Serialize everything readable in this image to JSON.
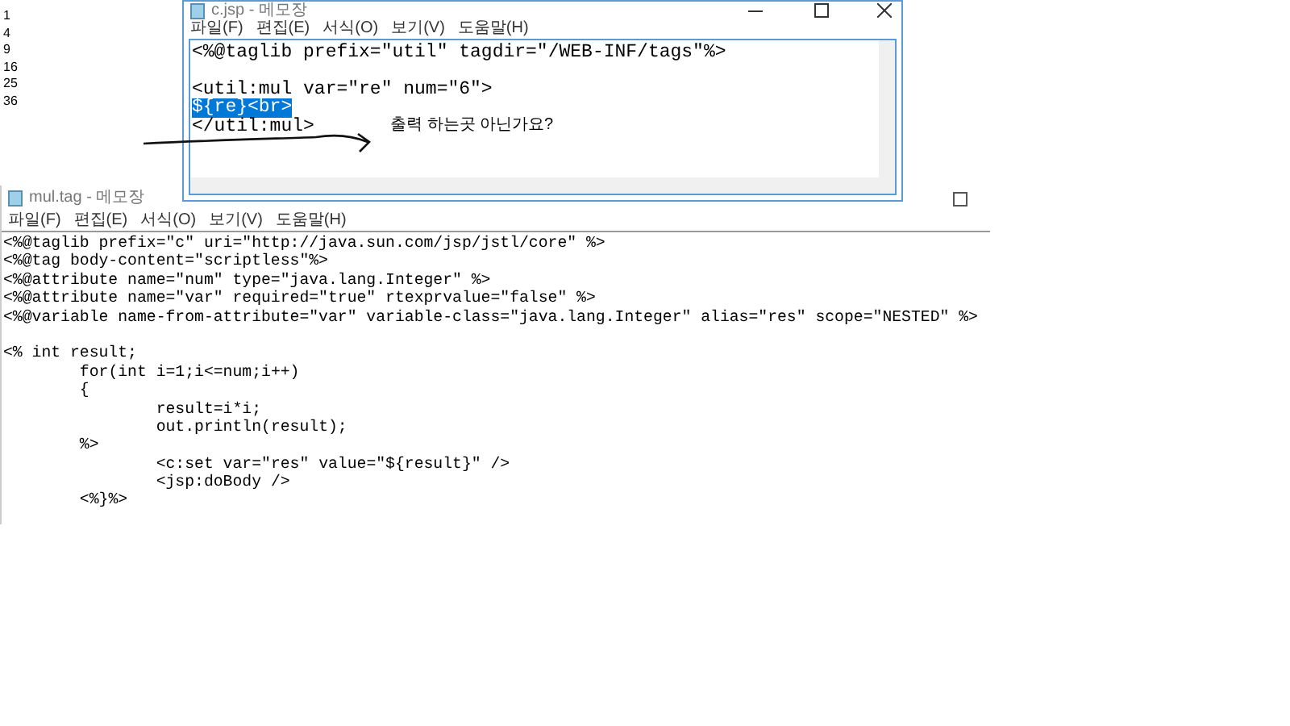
{
  "output_lines": [
    "1",
    "4",
    "9",
    "16",
    "25",
    "36"
  ],
  "top_window": {
    "title": "c.jsp - 메모장",
    "menu": [
      "파일(F)",
      "편집(E)",
      "서식(O)",
      "보기(V)",
      "도움말(H)"
    ],
    "lines": [
      {
        "kind": "text",
        "text": "<%@taglib prefix=\"util\" tagdir=\"/WEB-INF/tags\"%>",
        "selected": false
      },
      {
        "kind": "blank"
      },
      {
        "kind": "text",
        "text": "<util:mul var=\"re\" num=\"6\">",
        "selected": false
      },
      {
        "kind": "text",
        "text": "${re}<br>",
        "selected": true
      },
      {
        "kind": "text",
        "text": "</util:mul>",
        "selected": false
      }
    ],
    "annotation": "출력 하는곳 아닌가요?"
  },
  "bottom_window": {
    "title": "mul.tag - 메모장",
    "menu": [
      "파일(F)",
      "편집(E)",
      "서식(O)",
      "보기(V)",
      "도움말(H)"
    ],
    "lines": [
      {
        "kind": "text",
        "text": "<%@taglib prefix=\"c\" uri=\"http://java.sun.com/jsp/jstl/core\" %>",
        "selected": false
      },
      {
        "kind": "text",
        "text": "<%@tag body-content=\"scriptless\"%>",
        "selected": false
      },
      {
        "kind": "text",
        "text": "<%@attribute name=\"num\" type=\"java.lang.Integer\" %>",
        "selected": false
      },
      {
        "kind": "text",
        "text": "<%@attribute name=\"var\" required=\"true\" rtexprvalue=\"false\" %>",
        "selected": false
      },
      {
        "kind": "text",
        "text": "<%@variable name-from-attribute=\"var\" variable-class=\"java.lang.Integer\" alias=\"res\" scope=\"NESTED\" %>",
        "selected": false
      },
      {
        "kind": "blank"
      },
      {
        "kind": "text",
        "text": "<% int result;",
        "selected": false
      },
      {
        "kind": "text",
        "text": "\tfor(int i=1;i<=num;i++)",
        "selected": false
      },
      {
        "kind": "text",
        "text": "\t{",
        "selected": false
      },
      {
        "kind": "text",
        "text": "\t\tresult=i*i;",
        "selected": false
      },
      {
        "kind": "text",
        "text": "\t\tout.println(result);",
        "selected": false
      },
      {
        "kind": "text",
        "text": "\t%>",
        "selected": false
      },
      {
        "kind": "text",
        "text": "\t\t<c:set var=\"res\" value=\"${result}\" />",
        "selected": false
      },
      {
        "kind": "text",
        "text": "\t\t<jsp:doBody />",
        "selected": false
      },
      {
        "kind": "text",
        "text": "\t<%}%>",
        "selected": false
      }
    ]
  }
}
